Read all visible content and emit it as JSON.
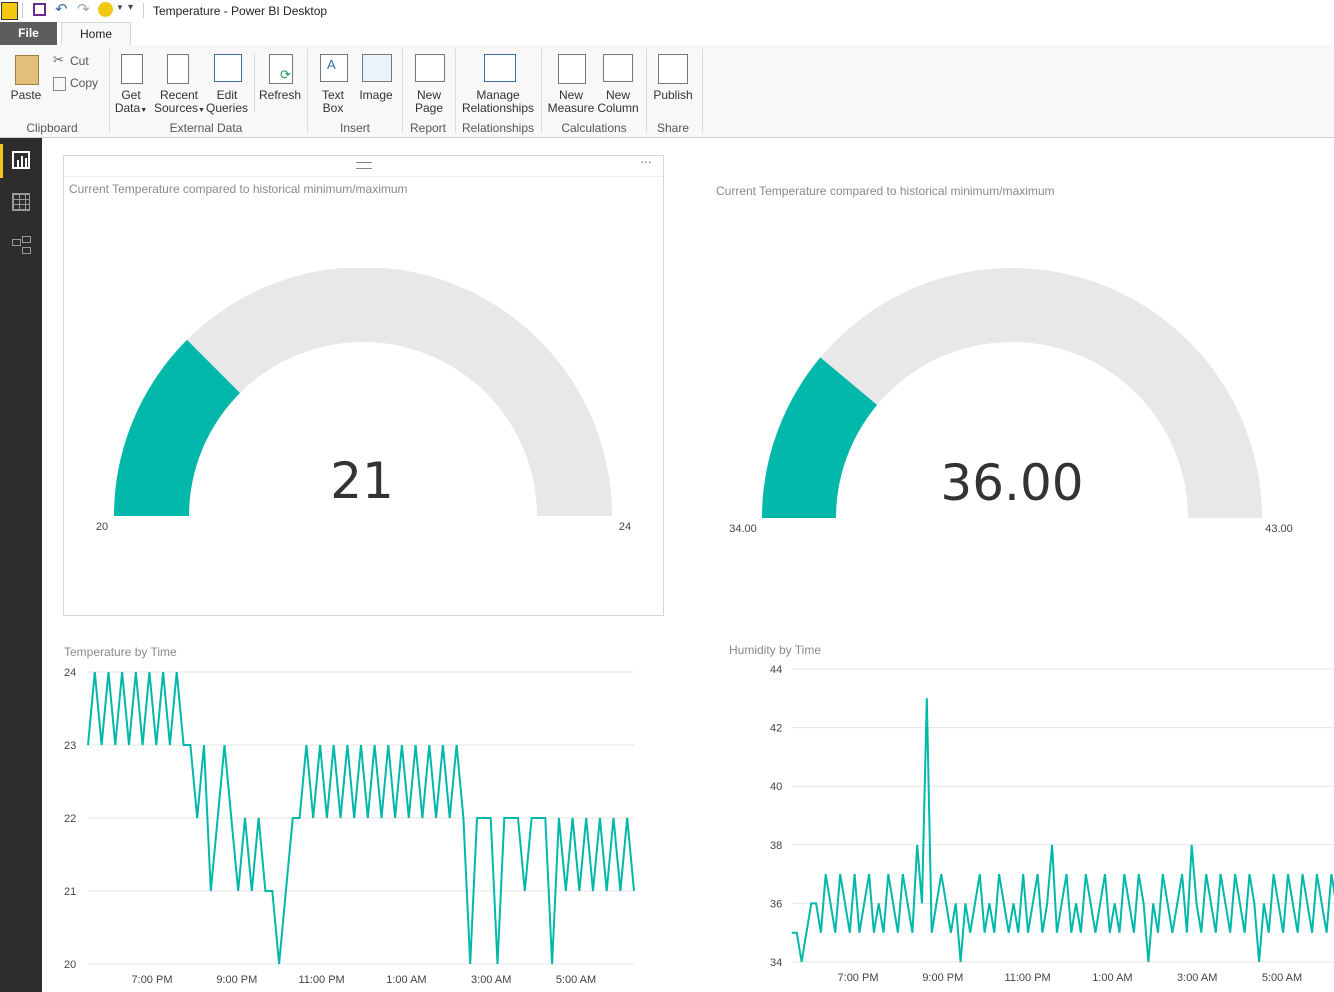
{
  "window": {
    "title": "Temperature - Power BI Desktop"
  },
  "tabs": {
    "file": "File",
    "home": "Home"
  },
  "ribbon": {
    "clipboard": {
      "paste": "Paste",
      "cut": "Cut",
      "copy": "Copy",
      "group": "Clipboard"
    },
    "external": {
      "get_data_1": "Get",
      "get_data_2": "Data",
      "recent_1": "Recent",
      "recent_2": "Sources",
      "edit_1": "Edit",
      "edit_2": "Queries",
      "refresh": "Refresh",
      "group": "External Data"
    },
    "insert": {
      "text_1": "Text",
      "text_2": "Box",
      "image": "Image",
      "group": "Insert"
    },
    "report": {
      "new_1": "New",
      "new_2": "Page",
      "group": "Report"
    },
    "relationships": {
      "manage_1": "Manage",
      "manage_2": "Relationships",
      "group": "Relationships"
    },
    "calculations": {
      "measure_1": "New",
      "measure_2": "Measure",
      "column_1": "New",
      "column_2": "Column",
      "group": "Calculations"
    },
    "share": {
      "publish": "Publish",
      "group": "Share"
    }
  },
  "visuals": {
    "gauge1": {
      "title": "Current Temperature compared to historical minimum/maximum",
      "value": "21",
      "min_label": "20",
      "max_label": "24",
      "fill_fraction": 0.25
    },
    "gauge2": {
      "title": "Current Temperature compared to historical minimum/maximum",
      "value": "36.00",
      "min_label": "34.00",
      "max_label": "43.00",
      "fill_fraction": 0.222
    },
    "temp_chart": {
      "title": "Temperature by Time"
    },
    "humidity_chart": {
      "title": "Humidity by Time"
    }
  },
  "colors": {
    "accent": "#01B8AA",
    "gauge_track": "#E8E8E8",
    "nav_bg": "#2D2D2D",
    "nav_active": "#F2C811"
  },
  "chart_data": [
    {
      "type": "line",
      "title": "Temperature by Time",
      "ylim": [
        20,
        24
      ],
      "yticks": [
        "24",
        "23",
        "22",
        "21",
        "20"
      ],
      "xticks": [
        "7:00 PM",
        "9:00 PM",
        "11:00 PM",
        "1:00 AM",
        "3:00 AM",
        "5:00 AM"
      ],
      "xlim": [
        "5:30 PM",
        "6:30 AM"
      ],
      "series": [
        {
          "values": [
            23,
            24,
            23,
            24,
            23,
            24,
            23,
            24,
            23,
            24,
            23,
            24,
            23,
            24,
            23,
            23,
            22,
            23,
            21,
            22,
            23,
            22,
            21,
            22,
            21,
            22,
            21,
            21,
            20,
            21,
            22,
            22,
            23,
            22,
            23,
            22,
            23,
            22,
            23,
            22,
            23,
            22,
            23,
            22,
            23,
            22,
            23,
            22,
            23,
            22,
            23,
            22,
            23,
            22,
            23,
            22,
            20,
            22,
            22,
            22,
            20,
            22,
            22,
            22,
            21,
            22,
            22,
            22,
            20,
            22,
            21,
            22,
            21,
            22,
            21,
            22,
            21,
            22,
            21,
            22,
            21
          ]
        }
      ]
    },
    {
      "type": "line",
      "title": "Humidity by Time",
      "ylim": [
        34,
        44
      ],
      "yticks": [
        "44",
        "42",
        "40",
        "38",
        "36",
        "34"
      ],
      "xticks": [
        "7:00 PM",
        "9:00 PM",
        "11:00 PM",
        "1:00 AM",
        "3:00 AM",
        "5:00 AM"
      ],
      "xlim": [
        "5:30 PM",
        "6:30 AM"
      ],
      "series": [
        {
          "values": [
            35,
            35,
            34,
            35,
            36,
            36,
            35,
            37,
            36,
            35,
            37,
            36,
            35,
            37,
            35,
            36,
            37,
            35,
            36,
            35,
            37,
            36,
            35,
            37,
            36,
            35,
            38,
            36,
            43,
            35,
            36,
            37,
            36,
            35,
            36,
            34,
            36,
            35,
            36,
            37,
            35,
            36,
            35,
            37,
            36,
            35,
            36,
            35,
            37,
            35,
            36,
            37,
            35,
            36,
            38,
            35,
            36,
            37,
            35,
            36,
            35,
            37,
            36,
            35,
            36,
            37,
            35,
            36,
            35,
            37,
            36,
            35,
            37,
            36,
            34,
            36,
            35,
            37,
            36,
            35,
            36,
            37,
            35,
            38,
            36,
            35,
            37,
            36,
            35,
            37,
            36,
            35,
            37,
            36,
            35,
            37,
            36,
            34,
            36,
            35,
            37,
            36,
            35,
            37,
            36,
            35,
            37,
            36,
            35,
            37,
            36,
            35,
            37,
            36,
            35
          ]
        }
      ]
    }
  ]
}
